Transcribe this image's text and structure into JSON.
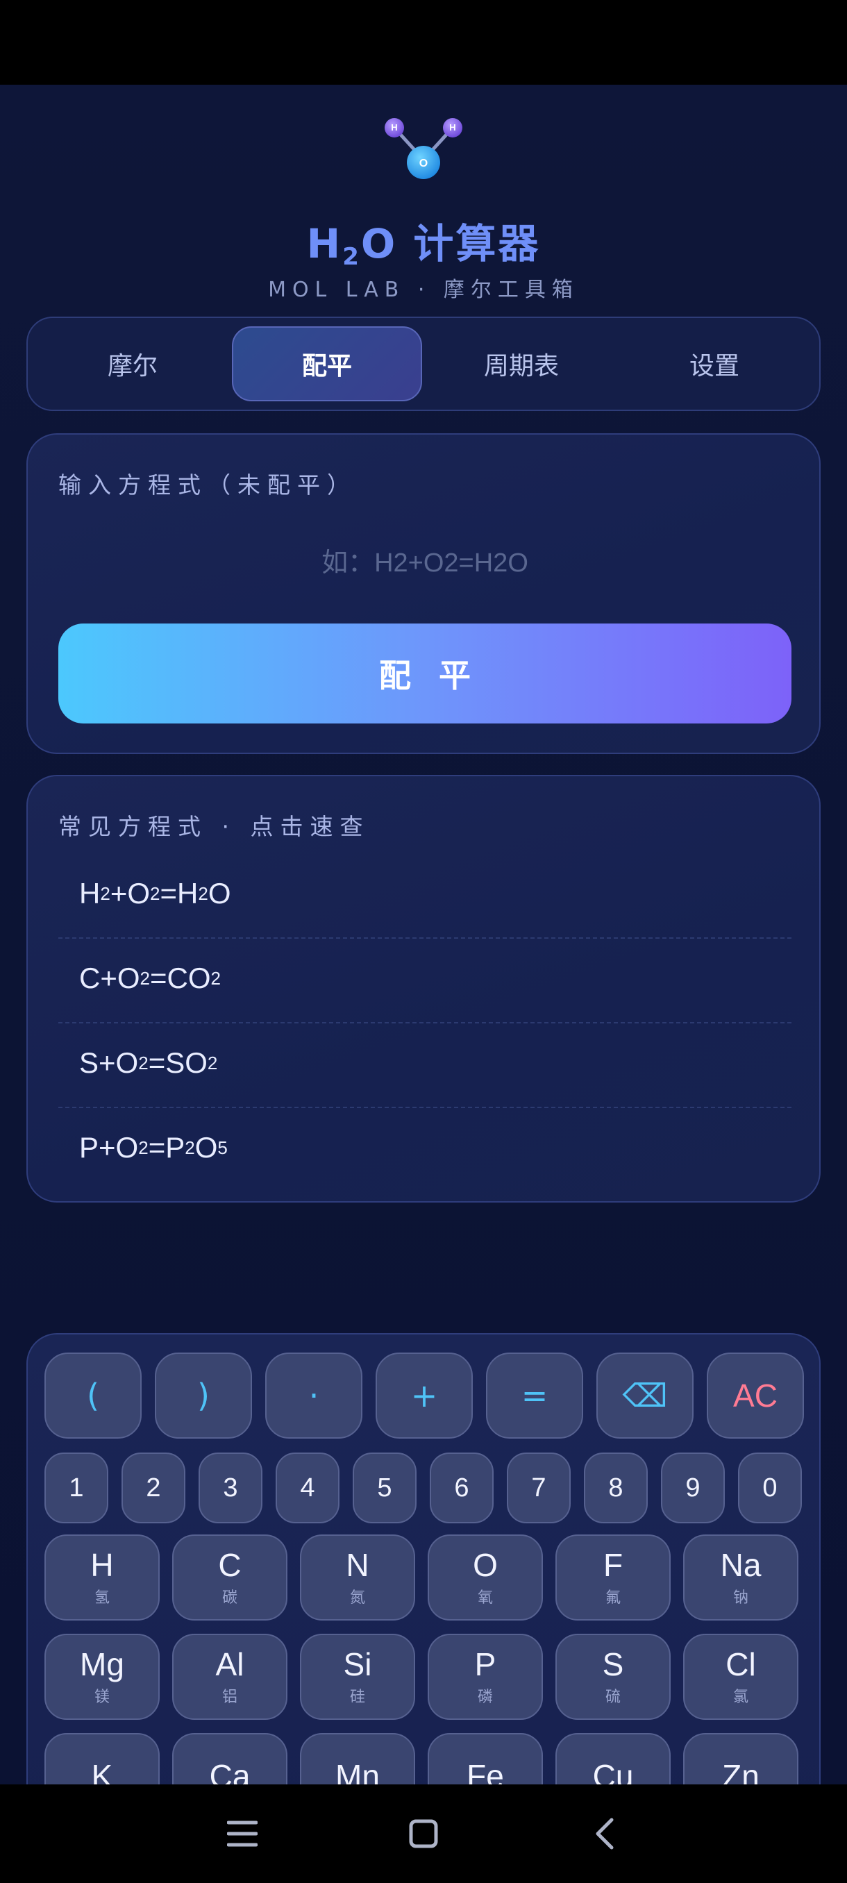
{
  "header": {
    "title_prefix": "H",
    "title_sub": "2",
    "title_rest": "O 计算器",
    "subtitle": "MOL LAB · 摩尔工具箱",
    "logo_atoms": [
      "H",
      "H",
      "O"
    ]
  },
  "tabs": [
    {
      "label": "摩尔",
      "active": false
    },
    {
      "label": "配平",
      "active": true
    },
    {
      "label": "周期表",
      "active": false
    },
    {
      "label": "设置",
      "active": false
    }
  ],
  "balance_card": {
    "label": "输入方程式（未配平）",
    "input_value": "",
    "input_placeholder": "如：H2+O2=H2O",
    "button_label": "配平"
  },
  "common_card": {
    "label": "常见方程式 · 点击速查",
    "equations": [
      [
        [
          "H",
          ""
        ],
        [
          "2",
          "sub"
        ],
        [
          "+O",
          ""
        ],
        [
          "2",
          "sub"
        ],
        [
          "=H",
          ""
        ],
        [
          "2",
          "sub"
        ],
        [
          "O",
          ""
        ]
      ],
      [
        [
          "C+O",
          ""
        ],
        [
          "2",
          "sub"
        ],
        [
          "=CO",
          ""
        ],
        [
          "2",
          "sub"
        ]
      ],
      [
        [
          "S+O",
          ""
        ],
        [
          "2",
          "sub"
        ],
        [
          "=SO",
          ""
        ],
        [
          "2",
          "sub"
        ]
      ],
      [
        [
          "P+O",
          ""
        ],
        [
          "2",
          "sub"
        ],
        [
          "=P",
          ""
        ],
        [
          "2",
          "sub"
        ],
        [
          "O",
          ""
        ],
        [
          "5",
          "sub"
        ]
      ]
    ]
  },
  "keypad": {
    "symbols": [
      "(",
      ")",
      "·",
      "+",
      "=",
      "⌫",
      "AC"
    ],
    "digits": [
      "1",
      "2",
      "3",
      "4",
      "5",
      "6",
      "7",
      "8",
      "9",
      "0"
    ],
    "elements": [
      {
        "sym": "H",
        "cn": "氢"
      },
      {
        "sym": "C",
        "cn": "碳"
      },
      {
        "sym": "N",
        "cn": "氮"
      },
      {
        "sym": "O",
        "cn": "氧"
      },
      {
        "sym": "F",
        "cn": "氟"
      },
      {
        "sym": "Na",
        "cn": "钠"
      },
      {
        "sym": "Mg",
        "cn": "镁"
      },
      {
        "sym": "Al",
        "cn": "铝"
      },
      {
        "sym": "Si",
        "cn": "硅"
      },
      {
        "sym": "P",
        "cn": "磷"
      },
      {
        "sym": "S",
        "cn": "硫"
      },
      {
        "sym": "Cl",
        "cn": "氯"
      },
      {
        "sym": "K",
        "cn": ""
      },
      {
        "sym": "Ca",
        "cn": ""
      },
      {
        "sym": "Mn",
        "cn": ""
      },
      {
        "sym": "Fe",
        "cn": ""
      },
      {
        "sym": "Cu",
        "cn": ""
      },
      {
        "sym": "Zn",
        "cn": ""
      }
    ]
  },
  "colors": {
    "accent": "#6f8ff8",
    "symbol_key": "#4fc3f7",
    "clear_key": "#ff7b93",
    "button_gradient_start": "#4cc8fd",
    "button_gradient_end": "#7d62f9"
  },
  "nav": [
    "menu-icon",
    "home-icon",
    "back-icon"
  ]
}
